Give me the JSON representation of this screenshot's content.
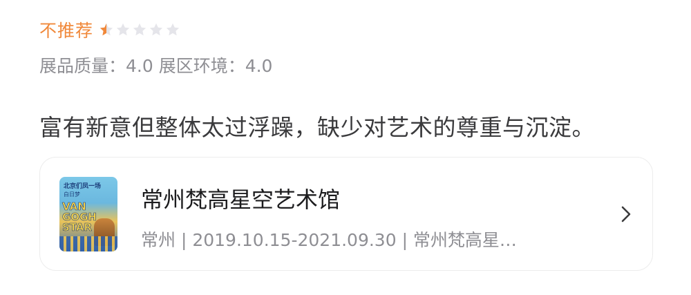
{
  "rating": {
    "label": "不推荐",
    "stars_total": 5,
    "stars_filled": 0.5,
    "star_filled_color": "#f0883a",
    "star_empty_color": "#e5e5ea"
  },
  "scores": {
    "text": "展品质量：4.0 展区环境：4.0"
  },
  "review": {
    "text": "富有新意但整体太过浮躁，缺少对艺术的尊重与沉淀。"
  },
  "venue_card": {
    "name": "常州梵高星空艺术馆",
    "meta": "常州 | 2019.10.15-2021.09.30 | 常州梵高星…",
    "thumbnail": {
      "line1": "北京们凤一场",
      "line2": "白日梦",
      "title": "VAN\nGOGH\nSTAR"
    },
    "chevron_icon": "chevron-right-icon"
  }
}
